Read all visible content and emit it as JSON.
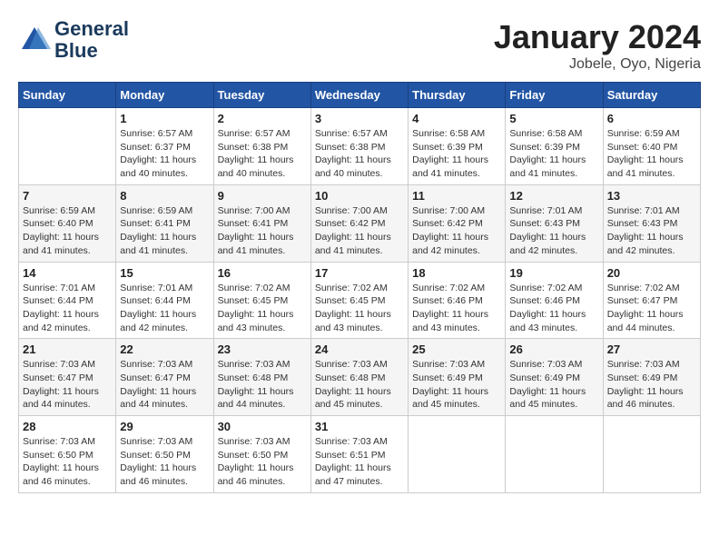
{
  "header": {
    "logo_line1": "General",
    "logo_line2": "Blue",
    "month": "January 2024",
    "location": "Jobele, Oyo, Nigeria"
  },
  "weekdays": [
    "Sunday",
    "Monday",
    "Tuesday",
    "Wednesday",
    "Thursday",
    "Friday",
    "Saturday"
  ],
  "weeks": [
    [
      {
        "day": "",
        "info": ""
      },
      {
        "day": "1",
        "info": "Sunrise: 6:57 AM\nSunset: 6:37 PM\nDaylight: 11 hours\nand 40 minutes."
      },
      {
        "day": "2",
        "info": "Sunrise: 6:57 AM\nSunset: 6:38 PM\nDaylight: 11 hours\nand 40 minutes."
      },
      {
        "day": "3",
        "info": "Sunrise: 6:57 AM\nSunset: 6:38 PM\nDaylight: 11 hours\nand 40 minutes."
      },
      {
        "day": "4",
        "info": "Sunrise: 6:58 AM\nSunset: 6:39 PM\nDaylight: 11 hours\nand 41 minutes."
      },
      {
        "day": "5",
        "info": "Sunrise: 6:58 AM\nSunset: 6:39 PM\nDaylight: 11 hours\nand 41 minutes."
      },
      {
        "day": "6",
        "info": "Sunrise: 6:59 AM\nSunset: 6:40 PM\nDaylight: 11 hours\nand 41 minutes."
      }
    ],
    [
      {
        "day": "7",
        "info": "Sunrise: 6:59 AM\nSunset: 6:40 PM\nDaylight: 11 hours\nand 41 minutes."
      },
      {
        "day": "8",
        "info": "Sunrise: 6:59 AM\nSunset: 6:41 PM\nDaylight: 11 hours\nand 41 minutes."
      },
      {
        "day": "9",
        "info": "Sunrise: 7:00 AM\nSunset: 6:41 PM\nDaylight: 11 hours\nand 41 minutes."
      },
      {
        "day": "10",
        "info": "Sunrise: 7:00 AM\nSunset: 6:42 PM\nDaylight: 11 hours\nand 41 minutes."
      },
      {
        "day": "11",
        "info": "Sunrise: 7:00 AM\nSunset: 6:42 PM\nDaylight: 11 hours\nand 42 minutes."
      },
      {
        "day": "12",
        "info": "Sunrise: 7:01 AM\nSunset: 6:43 PM\nDaylight: 11 hours\nand 42 minutes."
      },
      {
        "day": "13",
        "info": "Sunrise: 7:01 AM\nSunset: 6:43 PM\nDaylight: 11 hours\nand 42 minutes."
      }
    ],
    [
      {
        "day": "14",
        "info": "Sunrise: 7:01 AM\nSunset: 6:44 PM\nDaylight: 11 hours\nand 42 minutes."
      },
      {
        "day": "15",
        "info": "Sunrise: 7:01 AM\nSunset: 6:44 PM\nDaylight: 11 hours\nand 42 minutes."
      },
      {
        "day": "16",
        "info": "Sunrise: 7:02 AM\nSunset: 6:45 PM\nDaylight: 11 hours\nand 43 minutes."
      },
      {
        "day": "17",
        "info": "Sunrise: 7:02 AM\nSunset: 6:45 PM\nDaylight: 11 hours\nand 43 minutes."
      },
      {
        "day": "18",
        "info": "Sunrise: 7:02 AM\nSunset: 6:46 PM\nDaylight: 11 hours\nand 43 minutes."
      },
      {
        "day": "19",
        "info": "Sunrise: 7:02 AM\nSunset: 6:46 PM\nDaylight: 11 hours\nand 43 minutes."
      },
      {
        "day": "20",
        "info": "Sunrise: 7:02 AM\nSunset: 6:47 PM\nDaylight: 11 hours\nand 44 minutes."
      }
    ],
    [
      {
        "day": "21",
        "info": "Sunrise: 7:03 AM\nSunset: 6:47 PM\nDaylight: 11 hours\nand 44 minutes."
      },
      {
        "day": "22",
        "info": "Sunrise: 7:03 AM\nSunset: 6:47 PM\nDaylight: 11 hours\nand 44 minutes."
      },
      {
        "day": "23",
        "info": "Sunrise: 7:03 AM\nSunset: 6:48 PM\nDaylight: 11 hours\nand 44 minutes."
      },
      {
        "day": "24",
        "info": "Sunrise: 7:03 AM\nSunset: 6:48 PM\nDaylight: 11 hours\nand 45 minutes."
      },
      {
        "day": "25",
        "info": "Sunrise: 7:03 AM\nSunset: 6:49 PM\nDaylight: 11 hours\nand 45 minutes."
      },
      {
        "day": "26",
        "info": "Sunrise: 7:03 AM\nSunset: 6:49 PM\nDaylight: 11 hours\nand 45 minutes."
      },
      {
        "day": "27",
        "info": "Sunrise: 7:03 AM\nSunset: 6:49 PM\nDaylight: 11 hours\nand 46 minutes."
      }
    ],
    [
      {
        "day": "28",
        "info": "Sunrise: 7:03 AM\nSunset: 6:50 PM\nDaylight: 11 hours\nand 46 minutes."
      },
      {
        "day": "29",
        "info": "Sunrise: 7:03 AM\nSunset: 6:50 PM\nDaylight: 11 hours\nand 46 minutes."
      },
      {
        "day": "30",
        "info": "Sunrise: 7:03 AM\nSunset: 6:50 PM\nDaylight: 11 hours\nand 46 minutes."
      },
      {
        "day": "31",
        "info": "Sunrise: 7:03 AM\nSunset: 6:51 PM\nDaylight: 11 hours\nand 47 minutes."
      },
      {
        "day": "",
        "info": ""
      },
      {
        "day": "",
        "info": ""
      },
      {
        "day": "",
        "info": ""
      }
    ]
  ]
}
